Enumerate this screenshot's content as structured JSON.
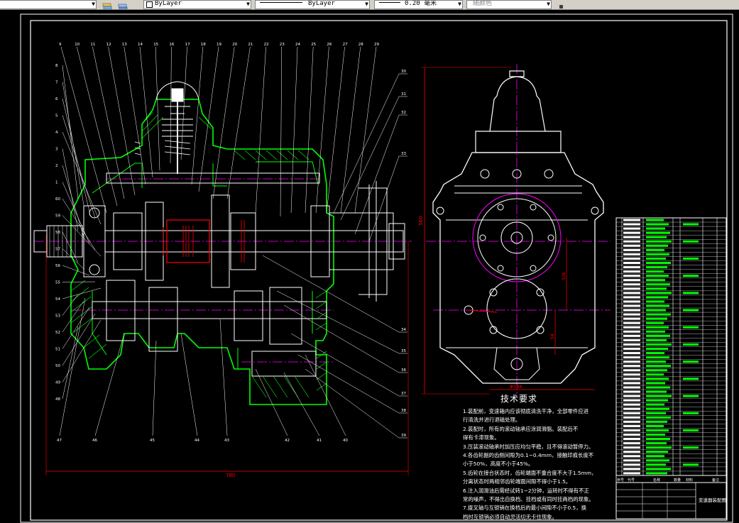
{
  "toolbar": {
    "layer_value": "ByLayer",
    "linetype_value": "ByLayer",
    "lineweight_value": "0.20 毫米",
    "color_value": "随颜色"
  },
  "drawing": {
    "tech_title": "技术要求",
    "tech_notes": [
      "1.装配前，变速箱内应该彻底清洗干净，全部零件应进",
      "行清洗并进行退磁处理。",
      "2.装配时，所有的滚动轴承应涂润滑脂。装配后不",
      "得有卡滞现象。",
      "3.压装滚动轴承时加压应均匀平稳，且不得滚动暂停力。",
      "4.各齿轮副的齿侧间隙为0.1~0.4mm，接触印痕长度不",
      "小于50%，高度不小于45%。",
      "5.齿轮在接合状态时，齿轮端面不重合度不大于1.5mm，",
      "分离状态时两相邻齿轮端面间隙不得小于1.5。",
      "6.注入润滑油后需经试转1~2分钟，运转时不得有不正",
      "常的噪声，不得出自换档、挂档或有同时挂两档的现象。",
      "7.拨叉轴与互锁销在换档后的最小间隙不小于0.5，换",
      "档时互锁销必须自动灵活切无卡住现象。"
    ],
    "top_callouts": [
      "9",
      "10",
      "11",
      "12",
      "13",
      "14",
      "15",
      "16",
      "17",
      "18",
      "19",
      "20",
      "21",
      "22",
      "23",
      "24",
      "25",
      "26",
      "27",
      "28",
      "29"
    ],
    "right_callouts": [
      "30",
      "31",
      "32",
      "33",
      "34",
      "35",
      "36",
      "37",
      "38",
      "39"
    ],
    "left_callouts": [
      "8",
      "7",
      "6",
      "5",
      "4",
      "3",
      "2",
      "1",
      "60",
      "59",
      "58",
      "57",
      "56",
      "55",
      "54",
      "53",
      "52",
      "51",
      "50",
      "49",
      "48"
    ],
    "bottom_callouts": [
      "47",
      "46",
      "45",
      "44",
      "43",
      "42",
      "41",
      "40"
    ],
    "dim_width": "780",
    "dim_height": "560",
    "dim_side_width": "Φ584",
    "dim_side_v1": "326",
    "dim_side_v2": "54",
    "title_block_name": "变速器装配图",
    "title_block_headers": [
      "序号",
      "代号",
      "名称",
      "数量",
      "材料",
      "备注"
    ]
  },
  "colors": {
    "outline": "#00ff00",
    "part": "#ffffff",
    "center": "#ff00ff",
    "dimension": "#ff0000",
    "frame": "#ffffff",
    "hatch": "#00ff00"
  }
}
